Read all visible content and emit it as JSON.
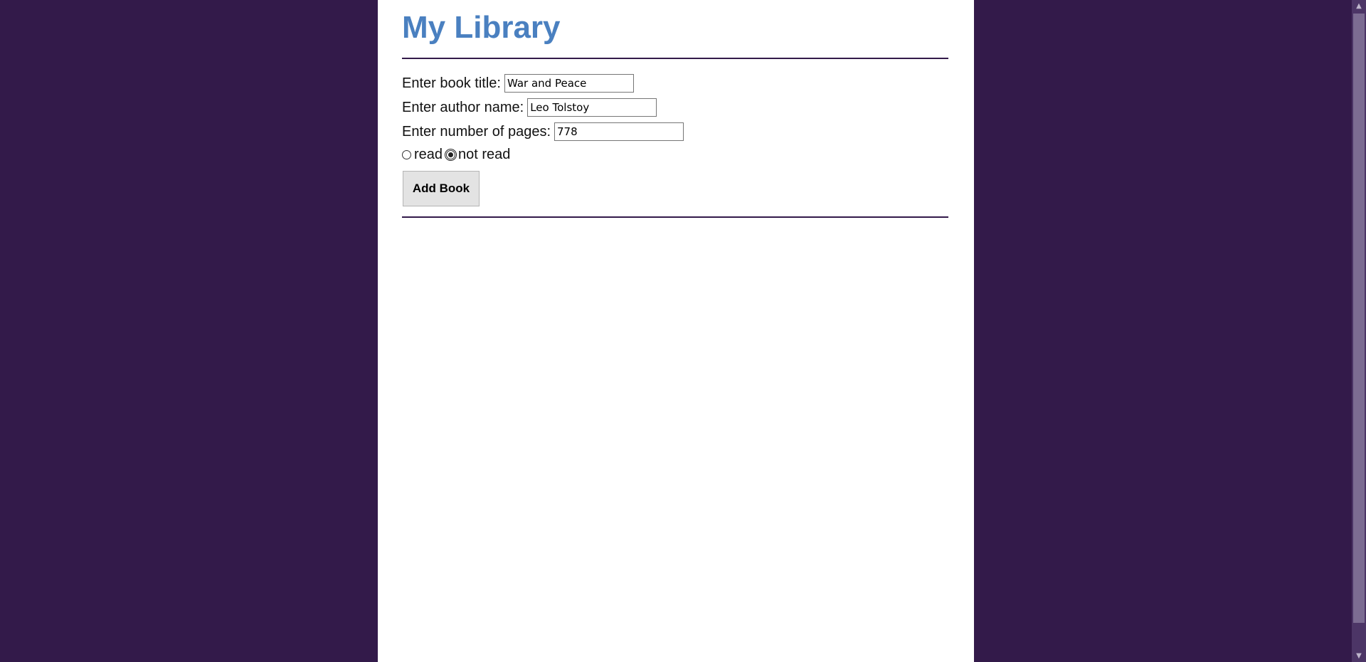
{
  "page": {
    "title": "My Library"
  },
  "form": {
    "title_label": "Enter book title:",
    "title_value": "War and Peace",
    "author_label": "Enter author name:",
    "author_value": "Leo Tolstoy",
    "pages_label": "Enter number of pages:",
    "pages_value": "778",
    "status_options": [
      "read",
      "not read"
    ],
    "status_selected": "not read",
    "submit_label": "Add Book"
  },
  "colors": {
    "background": "#331a4a",
    "title": "#4a80c0",
    "divider": "#331a4a"
  }
}
